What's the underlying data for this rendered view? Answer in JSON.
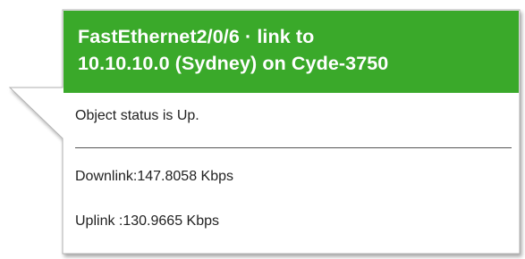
{
  "tooltip": {
    "title_line1": "FastEthernet2/0/6 · link to",
    "title_line2": "10.10.10.0 (Sydney) on Cyde-3750",
    "status_text": "Object status is Up.",
    "downlink_text": "Downlink:147.8058 Kbps",
    "uplink_text": "Uplink :130.9665 Kbps"
  },
  "colors": {
    "header_bg": "#3aa92a",
    "header_text": "#ffffff",
    "border": "#b0b0b0",
    "body_text": "#222222"
  }
}
